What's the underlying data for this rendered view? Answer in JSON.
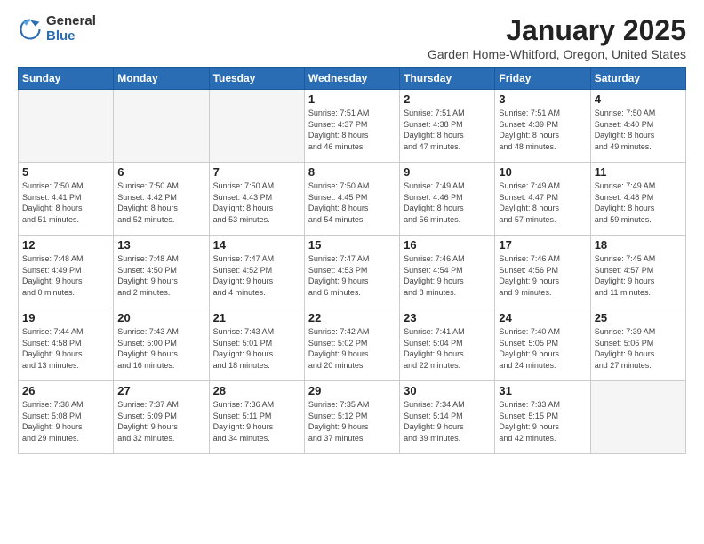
{
  "logo": {
    "general": "General",
    "blue": "Blue"
  },
  "header": {
    "month": "January 2025",
    "location": "Garden Home-Whitford, Oregon, United States"
  },
  "days_of_week": [
    "Sunday",
    "Monday",
    "Tuesday",
    "Wednesday",
    "Thursday",
    "Friday",
    "Saturday"
  ],
  "weeks": [
    [
      {
        "day": "",
        "info": ""
      },
      {
        "day": "",
        "info": ""
      },
      {
        "day": "",
        "info": ""
      },
      {
        "day": "1",
        "info": "Sunrise: 7:51 AM\nSunset: 4:37 PM\nDaylight: 8 hours\nand 46 minutes."
      },
      {
        "day": "2",
        "info": "Sunrise: 7:51 AM\nSunset: 4:38 PM\nDaylight: 8 hours\nand 47 minutes."
      },
      {
        "day": "3",
        "info": "Sunrise: 7:51 AM\nSunset: 4:39 PM\nDaylight: 8 hours\nand 48 minutes."
      },
      {
        "day": "4",
        "info": "Sunrise: 7:50 AM\nSunset: 4:40 PM\nDaylight: 8 hours\nand 49 minutes."
      }
    ],
    [
      {
        "day": "5",
        "info": "Sunrise: 7:50 AM\nSunset: 4:41 PM\nDaylight: 8 hours\nand 51 minutes."
      },
      {
        "day": "6",
        "info": "Sunrise: 7:50 AM\nSunset: 4:42 PM\nDaylight: 8 hours\nand 52 minutes."
      },
      {
        "day": "7",
        "info": "Sunrise: 7:50 AM\nSunset: 4:43 PM\nDaylight: 8 hours\nand 53 minutes."
      },
      {
        "day": "8",
        "info": "Sunrise: 7:50 AM\nSunset: 4:45 PM\nDaylight: 8 hours\nand 54 minutes."
      },
      {
        "day": "9",
        "info": "Sunrise: 7:49 AM\nSunset: 4:46 PM\nDaylight: 8 hours\nand 56 minutes."
      },
      {
        "day": "10",
        "info": "Sunrise: 7:49 AM\nSunset: 4:47 PM\nDaylight: 8 hours\nand 57 minutes."
      },
      {
        "day": "11",
        "info": "Sunrise: 7:49 AM\nSunset: 4:48 PM\nDaylight: 8 hours\nand 59 minutes."
      }
    ],
    [
      {
        "day": "12",
        "info": "Sunrise: 7:48 AM\nSunset: 4:49 PM\nDaylight: 9 hours\nand 0 minutes."
      },
      {
        "day": "13",
        "info": "Sunrise: 7:48 AM\nSunset: 4:50 PM\nDaylight: 9 hours\nand 2 minutes."
      },
      {
        "day": "14",
        "info": "Sunrise: 7:47 AM\nSunset: 4:52 PM\nDaylight: 9 hours\nand 4 minutes."
      },
      {
        "day": "15",
        "info": "Sunrise: 7:47 AM\nSunset: 4:53 PM\nDaylight: 9 hours\nand 6 minutes."
      },
      {
        "day": "16",
        "info": "Sunrise: 7:46 AM\nSunset: 4:54 PM\nDaylight: 9 hours\nand 8 minutes."
      },
      {
        "day": "17",
        "info": "Sunrise: 7:46 AM\nSunset: 4:56 PM\nDaylight: 9 hours\nand 9 minutes."
      },
      {
        "day": "18",
        "info": "Sunrise: 7:45 AM\nSunset: 4:57 PM\nDaylight: 9 hours\nand 11 minutes."
      }
    ],
    [
      {
        "day": "19",
        "info": "Sunrise: 7:44 AM\nSunset: 4:58 PM\nDaylight: 9 hours\nand 13 minutes."
      },
      {
        "day": "20",
        "info": "Sunrise: 7:43 AM\nSunset: 5:00 PM\nDaylight: 9 hours\nand 16 minutes."
      },
      {
        "day": "21",
        "info": "Sunrise: 7:43 AM\nSunset: 5:01 PM\nDaylight: 9 hours\nand 18 minutes."
      },
      {
        "day": "22",
        "info": "Sunrise: 7:42 AM\nSunset: 5:02 PM\nDaylight: 9 hours\nand 20 minutes."
      },
      {
        "day": "23",
        "info": "Sunrise: 7:41 AM\nSunset: 5:04 PM\nDaylight: 9 hours\nand 22 minutes."
      },
      {
        "day": "24",
        "info": "Sunrise: 7:40 AM\nSunset: 5:05 PM\nDaylight: 9 hours\nand 24 minutes."
      },
      {
        "day": "25",
        "info": "Sunrise: 7:39 AM\nSunset: 5:06 PM\nDaylight: 9 hours\nand 27 minutes."
      }
    ],
    [
      {
        "day": "26",
        "info": "Sunrise: 7:38 AM\nSunset: 5:08 PM\nDaylight: 9 hours\nand 29 minutes."
      },
      {
        "day": "27",
        "info": "Sunrise: 7:37 AM\nSunset: 5:09 PM\nDaylight: 9 hours\nand 32 minutes."
      },
      {
        "day": "28",
        "info": "Sunrise: 7:36 AM\nSunset: 5:11 PM\nDaylight: 9 hours\nand 34 minutes."
      },
      {
        "day": "29",
        "info": "Sunrise: 7:35 AM\nSunset: 5:12 PM\nDaylight: 9 hours\nand 37 minutes."
      },
      {
        "day": "30",
        "info": "Sunrise: 7:34 AM\nSunset: 5:14 PM\nDaylight: 9 hours\nand 39 minutes."
      },
      {
        "day": "31",
        "info": "Sunrise: 7:33 AM\nSunset: 5:15 PM\nDaylight: 9 hours\nand 42 minutes."
      },
      {
        "day": "",
        "info": ""
      }
    ]
  ]
}
